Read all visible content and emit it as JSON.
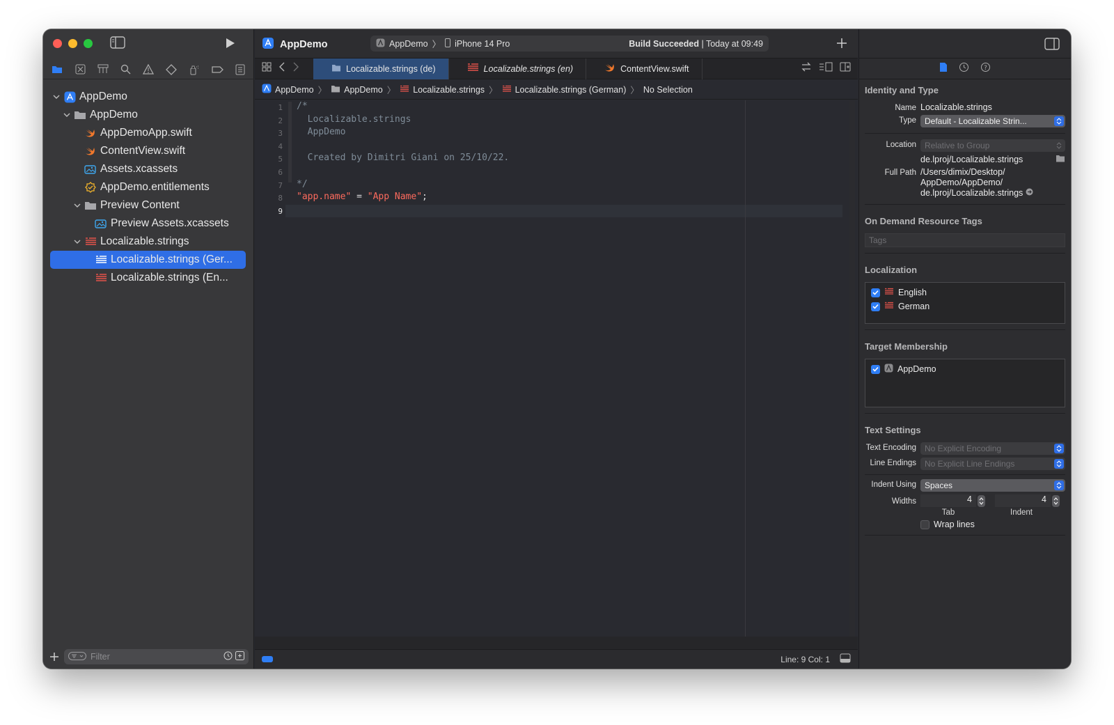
{
  "window": {
    "project_name": "AppDemo",
    "scheme": "AppDemo",
    "device": "iPhone 14 Pro",
    "build_status_bold": "Build Succeeded",
    "build_status_time": "| Today at 09:49"
  },
  "navigator": {
    "tree": [
      {
        "label": "AppDemo",
        "icon": "project-icon",
        "level": 0,
        "expanded": true
      },
      {
        "label": "AppDemo",
        "icon": "folder-icon",
        "level": 1,
        "expanded": true
      },
      {
        "label": "AppDemoApp.swift",
        "icon": "swift-icon",
        "level": 2
      },
      {
        "label": "ContentView.swift",
        "icon": "swift-icon",
        "level": 2
      },
      {
        "label": "Assets.xcassets",
        "icon": "asset-catalog-icon",
        "level": 2
      },
      {
        "label": "AppDemo.entitlements",
        "icon": "entitlements-icon",
        "level": 2
      },
      {
        "label": "Preview Content",
        "icon": "folder-icon",
        "level": 2,
        "expanded": true
      },
      {
        "label": "Preview Assets.xcassets",
        "icon": "asset-catalog-icon",
        "level": 3
      },
      {
        "label": "Localizable.strings",
        "icon": "strings-icon",
        "level": 2,
        "expanded": true
      },
      {
        "label": "Localizable.strings (Ger...",
        "icon": "strings-icon",
        "level": 3,
        "selected": true
      },
      {
        "label": "Localizable.strings (En...",
        "icon": "strings-icon",
        "level": 3
      }
    ],
    "filter_placeholder": "Filter"
  },
  "tabs": [
    {
      "label": "Localizable.strings (de)",
      "icon": "folder-icon",
      "active": true
    },
    {
      "label": "Localizable.strings (en)",
      "icon": "strings-icon",
      "italic": true
    },
    {
      "label": "ContentView.swift",
      "icon": "swift-icon"
    }
  ],
  "jumpbar": {
    "items": [
      "AppDemo",
      "AppDemo",
      "Localizable.strings",
      "Localizable.strings (German)",
      "No Selection"
    ]
  },
  "editor": {
    "line_numbers": [
      "1",
      "2",
      "3",
      "4",
      "5",
      "6",
      "7",
      "8",
      "9"
    ],
    "current_line": 9,
    "comment_lines": [
      "/*",
      "  Localizable.strings",
      "  AppDemo",
      "",
      "  Created by Dimitri Giani on 25/10/22.",
      "",
      "*/"
    ],
    "code_key": "\"app.name\"",
    "code_eq": " = ",
    "code_value": "\"App Name\"",
    "code_semicolon": ";"
  },
  "status": {
    "line_col": "Line: 9  Col: 1"
  },
  "inspector": {
    "identity_title": "Identity and Type",
    "name_label": "Name",
    "name_value": "Localizable.strings",
    "type_label": "Type",
    "type_value": "Default - Localizable Strin...",
    "location_label": "Location",
    "location_value": "Relative to Group",
    "location_path": "de.lproj/Localizable.strings",
    "fullpath_label": "Full Path",
    "fullpath_line1": "/Users/dimix/Desktop/",
    "fullpath_line2": "AppDemo/AppDemo/",
    "fullpath_line3": "de.lproj/Localizable.strings",
    "ondemand_title": "On Demand Resource Tags",
    "tags_placeholder": "Tags",
    "localization_title": "Localization",
    "localizations": [
      {
        "label": "English",
        "checked": true
      },
      {
        "label": "German",
        "checked": true
      }
    ],
    "target_title": "Target Membership",
    "targets": [
      {
        "label": "AppDemo",
        "checked": true
      }
    ],
    "text_settings_title": "Text Settings",
    "text_encoding_label": "Text Encoding",
    "text_encoding_value": "No Explicit Encoding",
    "line_endings_label": "Line Endings",
    "line_endings_value": "No Explicit Line Endings",
    "indent_using_label": "Indent Using",
    "indent_using_value": "Spaces",
    "widths_label": "Widths",
    "tab_width": "4",
    "indent_width": "4",
    "tab_caption": "Tab",
    "indent_caption": "Indent",
    "wrap_lines_label": "Wrap lines"
  },
  "colors": {
    "accent": "#2f6ee6",
    "string": "#fc6a5d",
    "comment": "#7f8c98",
    "swift": "#f0782c",
    "strings_icon": "#e6534b"
  }
}
